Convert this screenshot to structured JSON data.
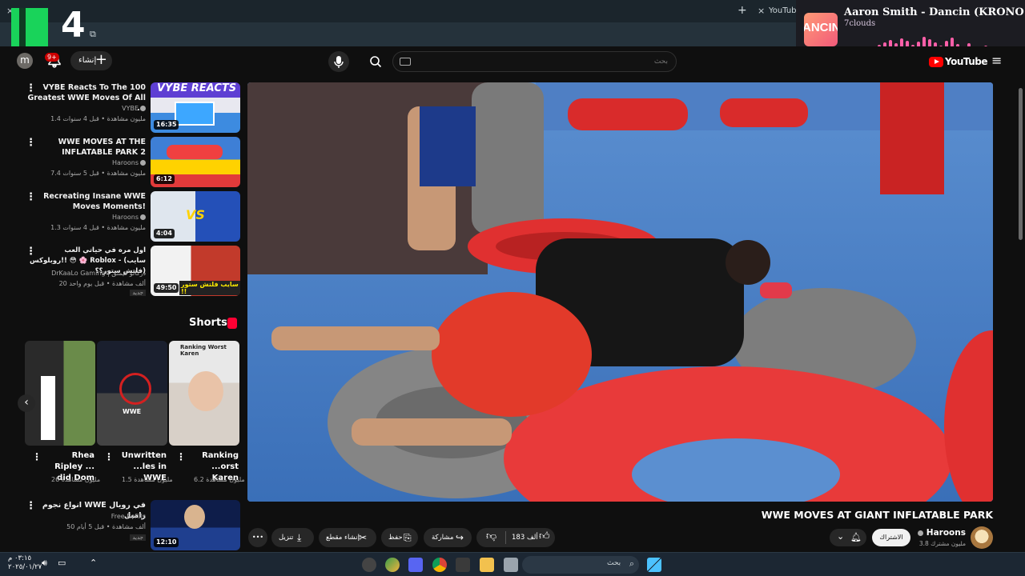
{
  "browser": {
    "tab_title": "YouTube",
    "new_tab": "+",
    "close_tab": "×"
  },
  "overlay_logo": {
    "letter": "K",
    "number": "4"
  },
  "music": {
    "title": "Aaron Smith - Dancin (KRONO Re...",
    "artist": "7clouds",
    "art_text": "ANCIN"
  },
  "header": {
    "avatar_letter": "m",
    "notifications_count": "9+",
    "create_label": "إنشاء",
    "search_placeholder": "بحث",
    "logo_text": "YouTube"
  },
  "recommended": [
    {
      "title": "VYBE Reacts To The 100 Greatest WWE Moves Of All ...",
      "channel": "VYBE",
      "meta": "1.4 مليون مشاهدة • قبل 4 سنوات",
      "duration": "16:35",
      "thumb_text": "VYBE REACTS"
    },
    {
      "title": "WWE MOVES AT THE INFLATABLE PARK 2",
      "channel": "Haroons",
      "meta": "7.4 مليون مشاهدة • قبل 5 سنوات",
      "duration": "6:12",
      "thumb_text": ""
    },
    {
      "title": "Recreating Insane WWE Moves Moments!",
      "channel": "Haroons",
      "meta": "1.3 مليون مشاهدة • قبل 4 سنوات",
      "duration": "4:04",
      "thumb_text": "VS"
    },
    {
      "title": "اول مره في حياتي العب روبلوكس!! 😳 🌸 Roblox - (سايب فلتش ستور؟؟)",
      "channel": "DrKaaLo Gaming | دركالو قيمنق",
      "meta": "20 ألف مشاهدة • قبل يوم واحد",
      "duration": "49:50",
      "thumb_text": "سايب فلتش ستور !!",
      "badge": "جديد"
    }
  ],
  "shorts": {
    "header": "Shorts",
    "items": [
      {
        "title": "Ranking ...orst Karen",
        "views": "6.2 مليون مشاهدة",
        "thumb_text": "Ranking Worst Karen"
      },
      {
        "title": "Unwritten ...les in WWE",
        "views": "1.5 مليون مشاهدة",
        "thumb_text": "WWE"
      },
      {
        "title": "Rhea Ripley ... did Dom",
        "views": "26 مليون مشاهدة",
        "thumb_text": ""
      }
    ]
  },
  "bottom_rec": {
    "title": "انواع نجوم WWE في رويال رامبل",
    "channel": "Free Refills",
    "meta": "50 ألف مشاهدة • قبل 5 أيام",
    "duration": "12:10",
    "badge": "جديد"
  },
  "video": {
    "title": "WWE MOVES AT GIANT INFLATABLE PARK",
    "channel": "Haroons",
    "subscribers": "3.8 مليون مشترك",
    "subscribe_label": "الاشتراك",
    "likes": "183 ألف",
    "share_label": "مشاركة",
    "save_label": "حفظ",
    "clip_label": "إنشاء مقطع",
    "download_label": "تنزيل",
    "more_label": "•••"
  },
  "taskbar": {
    "search_label": "بحث",
    "time": "٠٣:١٥ م",
    "date": "٢٠٢٥/٠١/٢٧"
  },
  "colors": {
    "background": "#0f0f0f",
    "accent_red": "#ff0000",
    "shorts_red": "#ff0033",
    "kick_green": "#19d35a",
    "viz_pink": "#ff5fa8"
  }
}
